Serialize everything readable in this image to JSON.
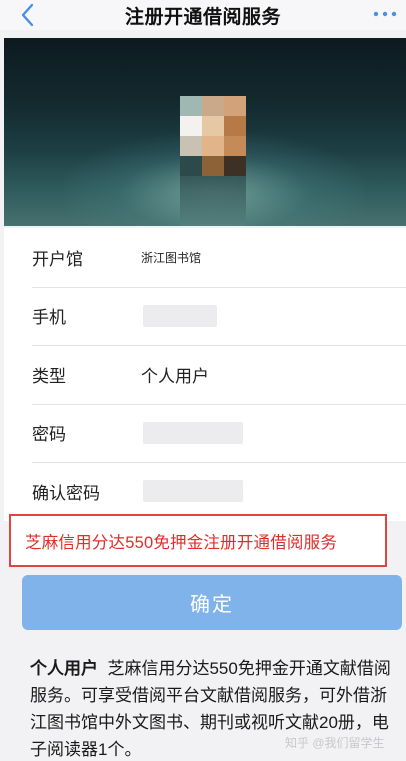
{
  "nav": {
    "title": "注册开通借阅服务"
  },
  "form": {
    "rows": [
      {
        "label": "开户馆",
        "value": "浙江图书馆"
      },
      {
        "label": "手机",
        "value": ""
      },
      {
        "label": "类型",
        "value": "个人用户"
      },
      {
        "label": "密码",
        "value": ""
      },
      {
        "label": "确认密码",
        "value": ""
      }
    ]
  },
  "promo": {
    "text": "芝麻信用分达550免押金注册开通借阅服务",
    "border_color": "#e0463f",
    "text_color": "#e02d2a"
  },
  "confirm_button": {
    "label": "确定",
    "color": "#7fb3ea"
  },
  "description": {
    "lead": "个人用户",
    "body": "芝麻信用分达550免押金开通文献借阅服务。可享受借阅平台文献借阅服务，可外借浙江图书馆中外文图书、期刊或视听文献20册，电子阅读器1个。"
  },
  "watermark": {
    "text": "知乎 @我们留学生"
  },
  "colors": {
    "accent": "#4a90e2",
    "background": "#f2f2f4"
  },
  "icons": {
    "back": "chevron-left-icon",
    "more": "more-dots-icon"
  }
}
